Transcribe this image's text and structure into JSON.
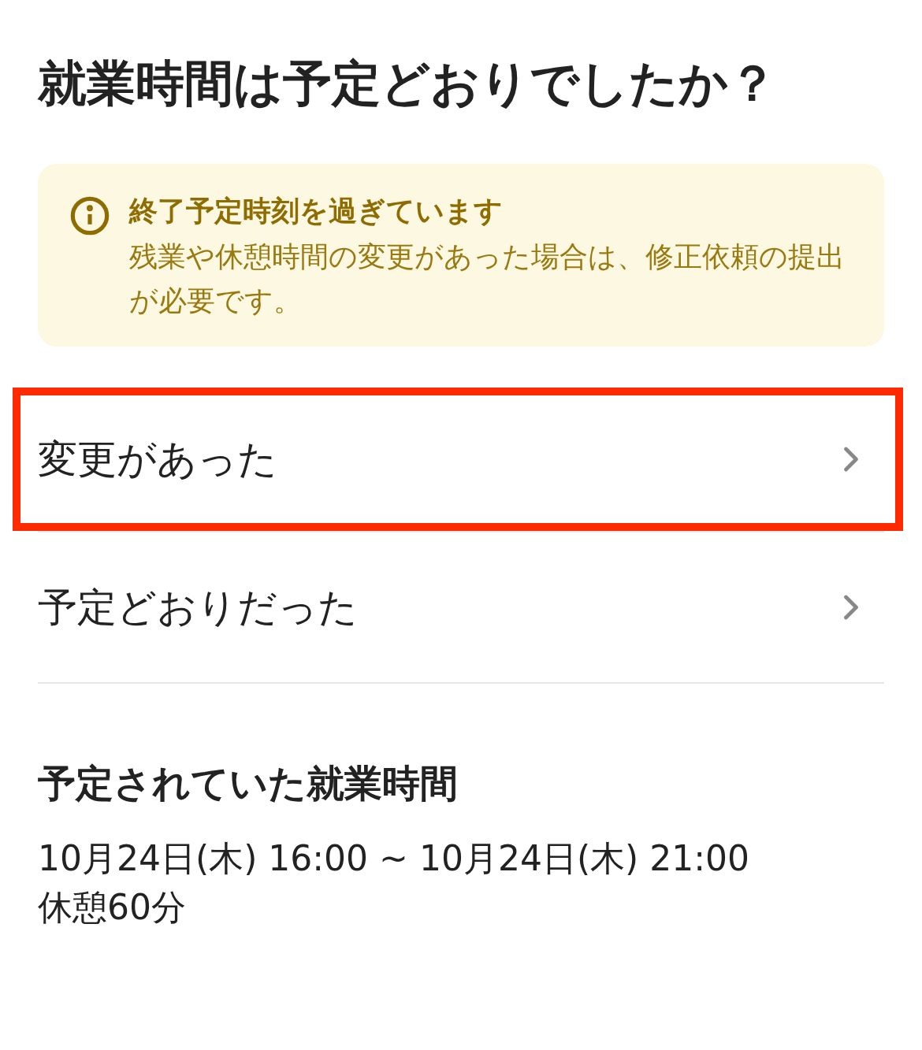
{
  "title": "就業時間は予定どおりでしたか？",
  "notice": {
    "title": "終了予定時刻を過ぎています",
    "body": "残業や休憩時間の変更があった場合は、修正依頼の提出が必要です。"
  },
  "options": [
    {
      "label": "変更があった",
      "highlighted": true
    },
    {
      "label": "予定どおりだった",
      "highlighted": false
    }
  ],
  "schedule": {
    "heading": "予定されていた就業時間",
    "time": "10月24日(木) 16:00 ~ 10月24日(木) 21:00",
    "break": "休憩60分"
  }
}
